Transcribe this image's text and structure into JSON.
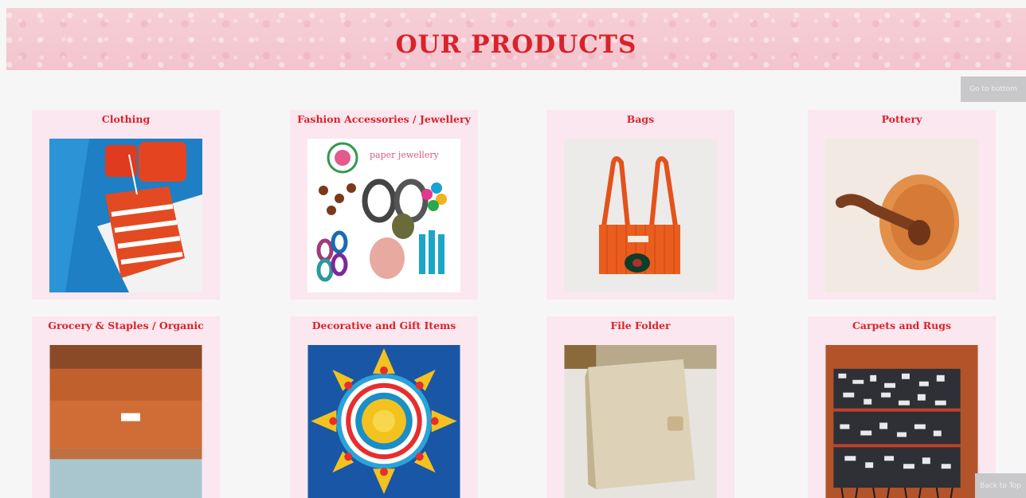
{
  "header": {
    "title": "OUR PRODUCTS"
  },
  "side_tab": {
    "label": "Go to bottom"
  },
  "back_to_top": {
    "label": "Back to Top"
  },
  "products": [
    {
      "label": "Clothing",
      "icon": "knitted-sweater-image"
    },
    {
      "label": "Fashion Accessories / Jewellery",
      "icon": "paper-jewellery-image",
      "image_caption": "paper jewellery"
    },
    {
      "label": "Bags",
      "icon": "orange-bag-image"
    },
    {
      "label": "Pottery",
      "icon": "wooden-bowl-spoon-image"
    },
    {
      "label": "Grocery & Staples / Organic",
      "icon": "grocery-packets-image"
    },
    {
      "label": "Decorative and Gift Items",
      "icon": "rangoli-mandala-image"
    },
    {
      "label": "File Folder",
      "icon": "file-folder-image"
    },
    {
      "label": "Carpets and Rugs",
      "icon": "rug-image"
    }
  ],
  "colors": {
    "title_red": "#d8232b",
    "card_bg": "#fbe7ef",
    "banner_pink": "#f3c4ce"
  }
}
